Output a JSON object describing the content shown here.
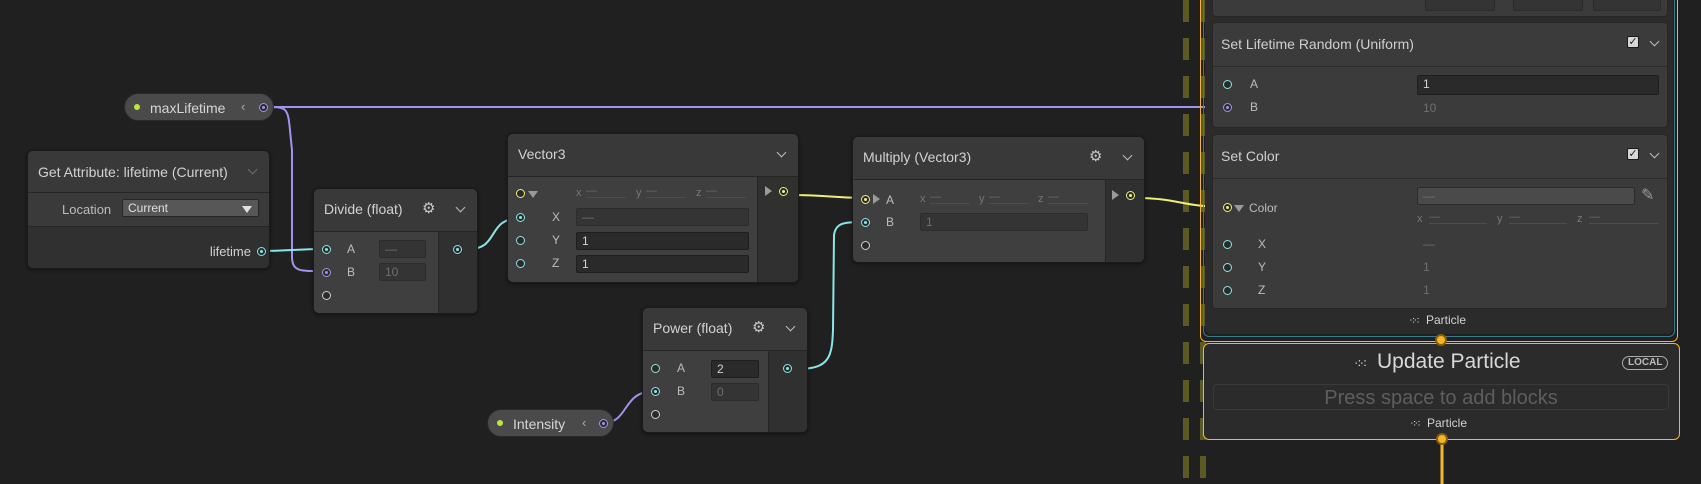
{
  "colors": {
    "background": "#202020",
    "float_wire": "#8ae6e6",
    "param_wire": "#a491ef",
    "vector_wire": "#f0ee7a",
    "flow_accent": "#f4b62a",
    "param_dot": "#b8e83c"
  },
  "params": {
    "max_lifetime": "maxLifetime",
    "intensity": "Intensity",
    "collapse_glyph": "‹"
  },
  "get_attribute": {
    "title": "Get Attribute: lifetime (Current)",
    "location_label": "Location",
    "location_value": "Current",
    "output_label": "lifetime"
  },
  "divide": {
    "title": "Divide (float)",
    "a_label": "A",
    "a_value": "—",
    "b_label": "B",
    "b_value": "10"
  },
  "vector3": {
    "title": "Vector3",
    "x_sub": "x",
    "y_sub": "y",
    "z_sub": "z",
    "x_label": "X",
    "x_value": "—",
    "y_label": "Y",
    "y_value": "1",
    "z_label": "Z",
    "z_value": "1"
  },
  "multiply": {
    "title": "Multiply (Vector3)",
    "a_label": "A",
    "b_label": "B",
    "b_value": "1",
    "x_sub": "x",
    "y_sub": "y",
    "z_sub": "z"
  },
  "power": {
    "title": "Power (float)",
    "a_label": "A",
    "a_value": "2",
    "b_label": "B",
    "b_value": "0"
  },
  "context_init": {
    "lifetime_block": {
      "title": "Set Lifetime Random (Uniform)",
      "a_label": "A",
      "a_value": "1",
      "b_label": "B",
      "b_value": "10"
    },
    "color_block": {
      "title": "Set Color",
      "color_label": "Color",
      "color_value": "—",
      "x_sub": "x",
      "y_sub": "y",
      "z_sub": "z",
      "x_label": "X",
      "x_value": "—",
      "y_label": "Y",
      "y_value": "1",
      "z_label": "Z",
      "z_value": "1"
    },
    "footer": "Particle"
  },
  "context_update": {
    "title": "Update Particle",
    "badge": "LOCAL",
    "placeholder": "Press space to add blocks",
    "footer": "Particle"
  },
  "icons": {
    "gear": "gear-icon",
    "chevron": "chevron-down-icon",
    "particle": "particle-icon",
    "eyedropper": "eyedropper-icon",
    "checkmark": "✓"
  }
}
